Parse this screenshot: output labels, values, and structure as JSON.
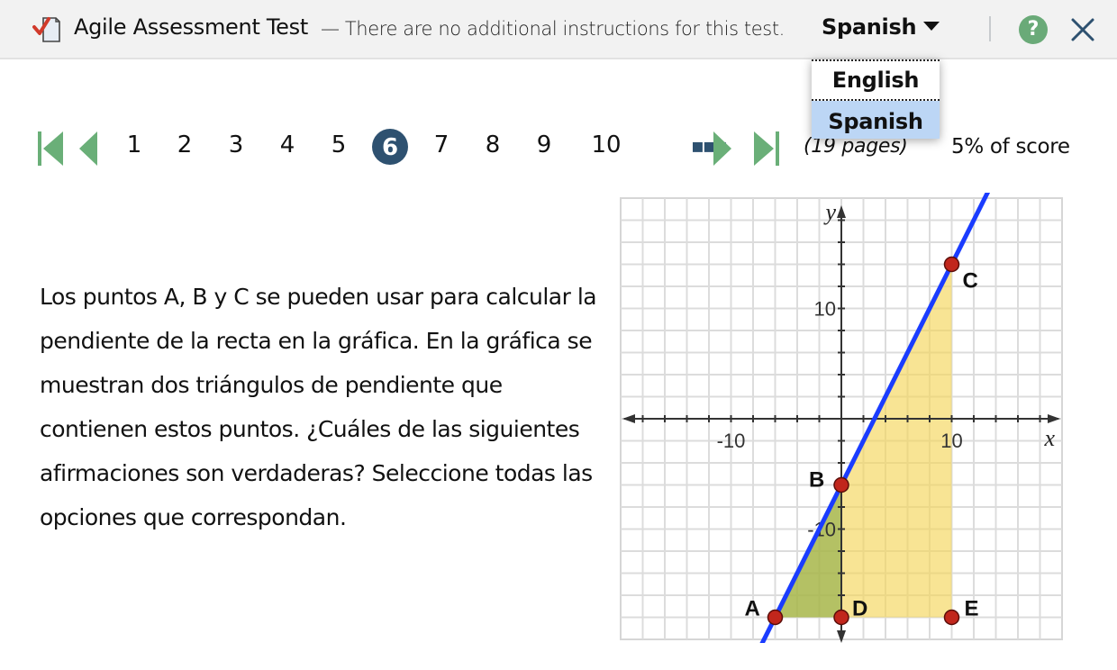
{
  "header": {
    "title": "Agile Assessment Test",
    "subtitle": "— There are no additional instructions for this test.",
    "language": "Spanish",
    "help_label": "?",
    "icons": {
      "app": "checked-document-icon",
      "help": "question-circle-icon",
      "close": "close-x-icon",
      "caret": "caret-down-icon"
    }
  },
  "language_menu": {
    "options": [
      "English",
      "Spanish"
    ],
    "selected": "Spanish"
  },
  "pager": {
    "pages": [
      "1",
      "2",
      "3",
      "4",
      "5",
      "6",
      "7",
      "8",
      "9",
      "10"
    ],
    "current": "6",
    "more_label": "▪▪▪",
    "total_label": "(19 pages)",
    "score_label": "5% of score",
    "colors": {
      "nav": "#6aaf78",
      "current": "#2e5170"
    }
  },
  "question": {
    "text": "Los puntos A, B y C se pueden usar para calcular la pendiente de la recta en la gráfica. En la gráfica se muestran dos triángulos de pendiente que contienen estos puntos. ¿Cuáles de las siguientes afirmaciones son verdaderas? Seleccione todas las opciones que correspondan."
  },
  "chart_data": {
    "type": "line",
    "title": "",
    "xlabel": "x",
    "ylabel": "y",
    "xlim": [
      -20,
      20
    ],
    "ylim": [
      -20,
      20
    ],
    "grid": true,
    "grid_step": 2,
    "x_ticks_labeled": [
      -10,
      10
    ],
    "y_ticks_labeled": [
      10,
      -10
    ],
    "line": {
      "slope": 2,
      "intercept": -6,
      "color": "#1a3cff"
    },
    "points": [
      {
        "label": "A",
        "x": -6,
        "y": -18
      },
      {
        "label": "B",
        "x": 0,
        "y": -6
      },
      {
        "label": "C",
        "x": 10,
        "y": 14
      },
      {
        "label": "D",
        "x": 0,
        "y": -18
      },
      {
        "label": "E",
        "x": 10,
        "y": -18
      }
    ],
    "triangles": [
      {
        "name": "yellow",
        "vertices": [
          "A",
          "C",
          "E"
        ],
        "color": "#f5d55a"
      },
      {
        "name": "green",
        "vertices": [
          "A",
          "B",
          "D"
        ],
        "color": "#8fad4a"
      }
    ]
  }
}
